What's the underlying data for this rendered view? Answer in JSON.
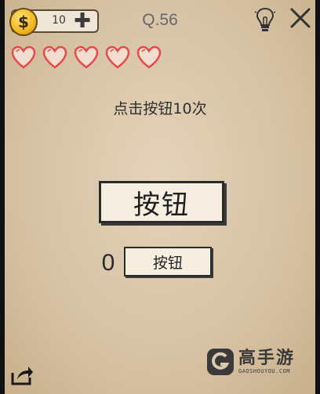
{
  "hud": {
    "coins": "10",
    "coin_symbol": "$",
    "plus_symbol": "✚",
    "level": "Q.56",
    "hearts": 5
  },
  "puzzle": {
    "instruction": "点击按钮10次",
    "big_button_label": "按钮",
    "counter": "0",
    "small_button_label": "按钮"
  },
  "watermark": {
    "brand": "高手游",
    "url": "GAOSHOUYOU.COM"
  },
  "colors": {
    "paper": "#dccab0",
    "ink": "#2b2b2b",
    "heart": "#e54a4a",
    "coin": "#f1b71f"
  }
}
